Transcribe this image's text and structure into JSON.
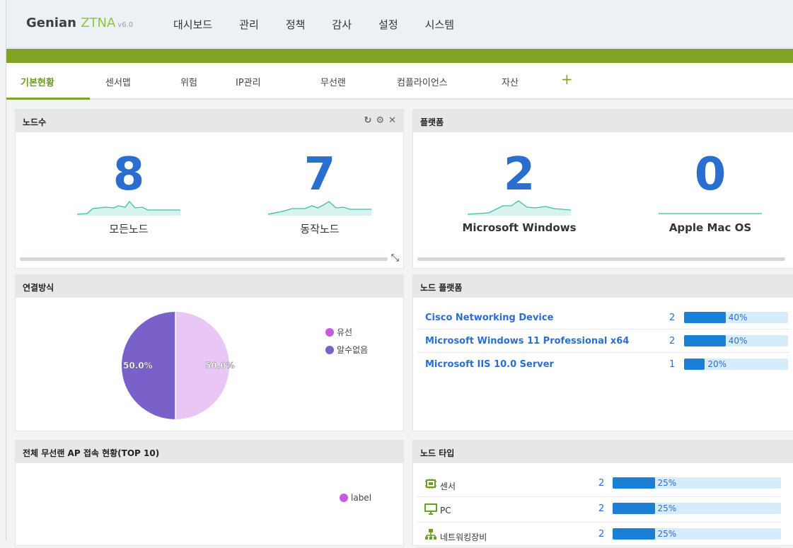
{
  "app": {
    "brand": "Genian",
    "product": "ZTNA",
    "version": "v6.0"
  },
  "nav": {
    "items": [
      "대시보드",
      "관리",
      "정책",
      "감사",
      "설정",
      "시스템"
    ]
  },
  "tabs": {
    "items": [
      "기본현황",
      "센서맵",
      "위험",
      "IP관리",
      "무선랜",
      "컴플라이언스",
      "자산"
    ],
    "active": "기본현황",
    "add_label": "+"
  },
  "widgets": {
    "nodes": {
      "title": "노드수",
      "stats": [
        {
          "value": "8",
          "label": "모든노드"
        },
        {
          "value": "7",
          "label": "동작노드"
        }
      ]
    },
    "platform": {
      "title": "플랫폼",
      "stats": [
        {
          "value": "2",
          "label": "Microsoft Windows"
        },
        {
          "value": "0",
          "label": "Apple Mac OS"
        }
      ]
    },
    "connection": {
      "title": "연결방식",
      "slices": [
        {
          "label": "유선",
          "percent_label": "50.0%",
          "fraction": 0.5,
          "color": "#e8c7f5"
        },
        {
          "label": "알수없음",
          "percent_label": "50.0%",
          "fraction": 0.5,
          "color": "#7a61c9"
        }
      ],
      "legend_colors": [
        "#c65be0",
        "#7a61c9"
      ]
    },
    "node_platform": {
      "title": "노드 플랫폼",
      "rows": [
        {
          "name": "Cisco Networking Device",
          "count": "2",
          "percent": "40%",
          "fraction": 0.4
        },
        {
          "name": "Microsoft Windows 11 Professional x64",
          "count": "2",
          "percent": "40%",
          "fraction": 0.4
        },
        {
          "name": "Microsoft IIS 10.0 Server",
          "count": "1",
          "percent": "20%",
          "fraction": 0.2
        }
      ]
    },
    "wireless": {
      "title": "전체 무선랜 AP 접속 현황(TOP 10)",
      "legend": "label",
      "legend_color": "#c65be0"
    },
    "node_type": {
      "title": "노드 타입",
      "rows": [
        {
          "name": "센서",
          "icon": "sensor-icon",
          "count": "2",
          "percent": "25%",
          "fraction": 0.25
        },
        {
          "name": "PC",
          "icon": "pc-icon",
          "count": "2",
          "percent": "25%",
          "fraction": 0.25
        },
        {
          "name": "네트워킹장비",
          "icon": "network-device-icon",
          "count": "2",
          "percent": "25%",
          "fraction": 0.25
        }
      ]
    }
  },
  "colors": {
    "accent": "#7fa423",
    "number": "#2a6fd0",
    "bar": "#1b7fd6",
    "bar_bg": "#d6ecfa",
    "sparkline": "#3bbfa8"
  }
}
